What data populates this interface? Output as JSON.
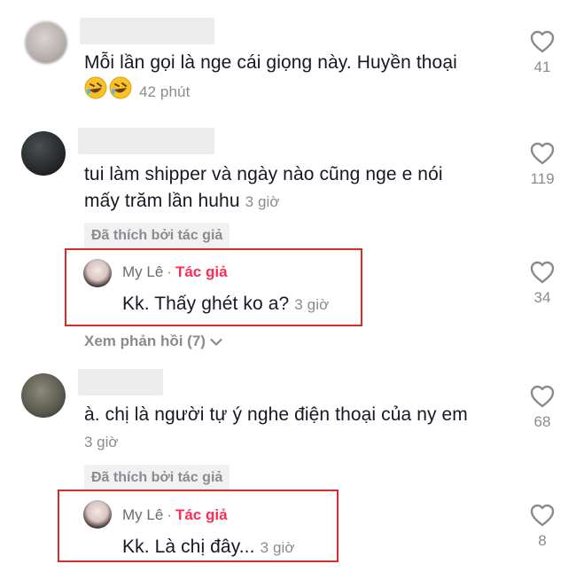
{
  "comments": [
    {
      "text": "Mỗi lần gọi là nge cái giọng này. Huyền thoại",
      "emoji_icons": [
        "rofl-icon",
        "rofl-icon"
      ],
      "time": "42 phút",
      "likes": "41"
    },
    {
      "line1": "tui làm shipper và ngày nào cũng nge e nói",
      "line2": "mấy trăm lần huhu",
      "time": "3 giờ",
      "liked_badge": "Đã thích bởi tác giả",
      "likes": "119",
      "reply": {
        "name": "My Lê",
        "separator": "·",
        "author_label": "Tác giả",
        "text": "Kk. Thấy ghét ko a?",
        "time": "3 giờ",
        "likes": "34"
      },
      "view_replies": "Xem phản hồi (7)"
    },
    {
      "text": "à. chị là người tự ý nghe điện thoại của ny em",
      "time": "3 giờ",
      "liked_badge": "Đã thích bởi tác giả",
      "likes": "68",
      "reply": {
        "name": "My Lê",
        "separator": "·",
        "author_label": "Tác giả",
        "text": "Kk. Là chị đây...",
        "time": "3 giờ",
        "likes": "8"
      }
    }
  ],
  "colors": {
    "author_accent": "#fe2c55",
    "highlight_border": "#d92b2b",
    "muted_text": "#8a8b91"
  }
}
